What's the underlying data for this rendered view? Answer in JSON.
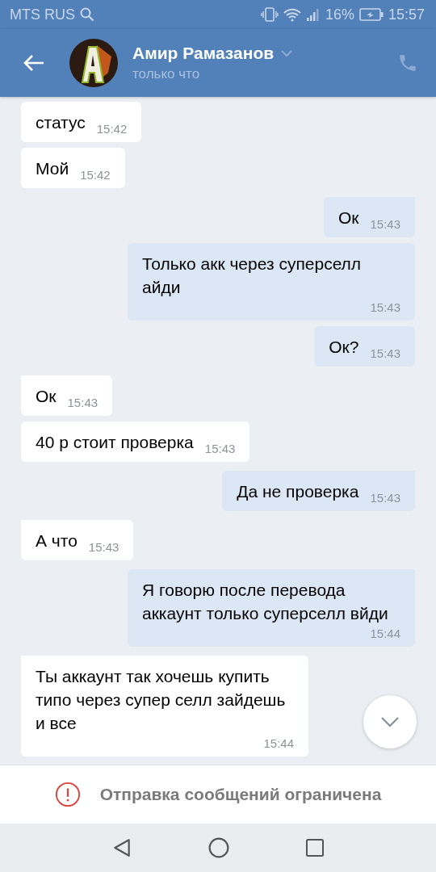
{
  "status_bar": {
    "carrier": "MTS RUS",
    "battery": "16%",
    "time": "15:57"
  },
  "header": {
    "name": "Амир Рамазанов",
    "status": "только что"
  },
  "messages": [
    {
      "outgoing": false,
      "text": "статус",
      "time": "15:42",
      "tail": false
    },
    {
      "outgoing": false,
      "text": "Мой",
      "time": "15:42",
      "tail": false
    },
    {
      "outgoing": true,
      "text": "Ок",
      "time": "15:43",
      "tail": true
    },
    {
      "outgoing": true,
      "text": "Только акк через суперселл айди",
      "time": "15:43",
      "tail": false
    },
    {
      "outgoing": true,
      "text": "Ок?",
      "time": "15:43",
      "tail": false
    },
    {
      "outgoing": false,
      "text": "Ок",
      "time": "15:43",
      "tail": true
    },
    {
      "outgoing": false,
      "text": "40 р стоит проверка",
      "time": "15:43",
      "tail": false
    },
    {
      "outgoing": true,
      "text": "Да не проверка",
      "time": "15:43",
      "tail": true
    },
    {
      "outgoing": false,
      "text": "А что",
      "time": "15:43",
      "tail": true
    },
    {
      "outgoing": true,
      "text": "Я говорю после перевода аккаунт только суперселл вйди",
      "time": "15:44",
      "tail": true
    },
    {
      "outgoing": false,
      "text": "Ты аккаунт так хочешь купить типо через супер селл зайдешь и все",
      "time": "15:44",
      "tail": true
    }
  ],
  "notice": {
    "text": "Отправка сообщений ограничена"
  }
}
